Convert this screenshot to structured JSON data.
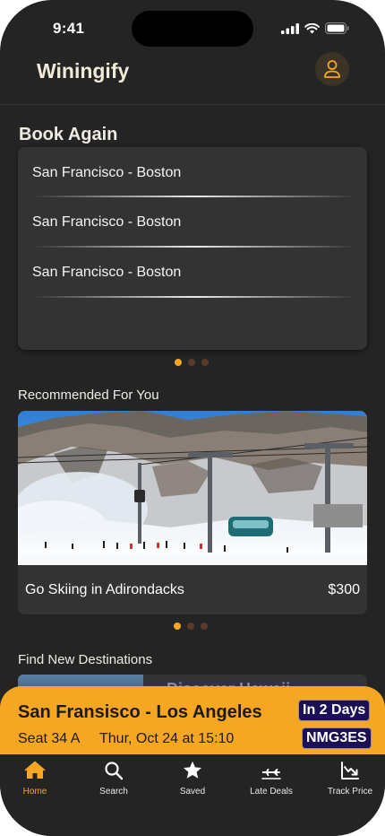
{
  "status": {
    "time": "9:41"
  },
  "app": {
    "title": "Winingify"
  },
  "book_again": {
    "title": "Book Again",
    "routes": [
      "San Francisco - Boston",
      "San Francisco - Boston",
      "San Francisco - Boston"
    ]
  },
  "recommended": {
    "title": "Recommended For You",
    "item": {
      "name": "Go Skiing in Adirondacks",
      "price": "$300"
    }
  },
  "find": {
    "title": "Find New Destinations",
    "peek_text": "Discover Hawaii"
  },
  "upcoming_trip": {
    "route": "San Fransisco - Los Angeles",
    "days_badge": "In 2 Days",
    "seat": "Seat 34 A",
    "datetime": "Thur, Oct 24 at 15:10",
    "booking_code": "NMG3ES"
  },
  "tabs": [
    {
      "label": "Home",
      "icon": "home-icon",
      "active": true
    },
    {
      "label": "Search",
      "icon": "search-icon"
    },
    {
      "label": "Saved",
      "icon": "star-icon"
    },
    {
      "label": "Late Deals",
      "icon": "plane-icon"
    },
    {
      "label": "Track Price",
      "icon": "chart-down-icon"
    }
  ],
  "colors": {
    "background": "#242424",
    "card": "#333333",
    "accent": "#f5a623",
    "badge": "#1d0f56"
  }
}
